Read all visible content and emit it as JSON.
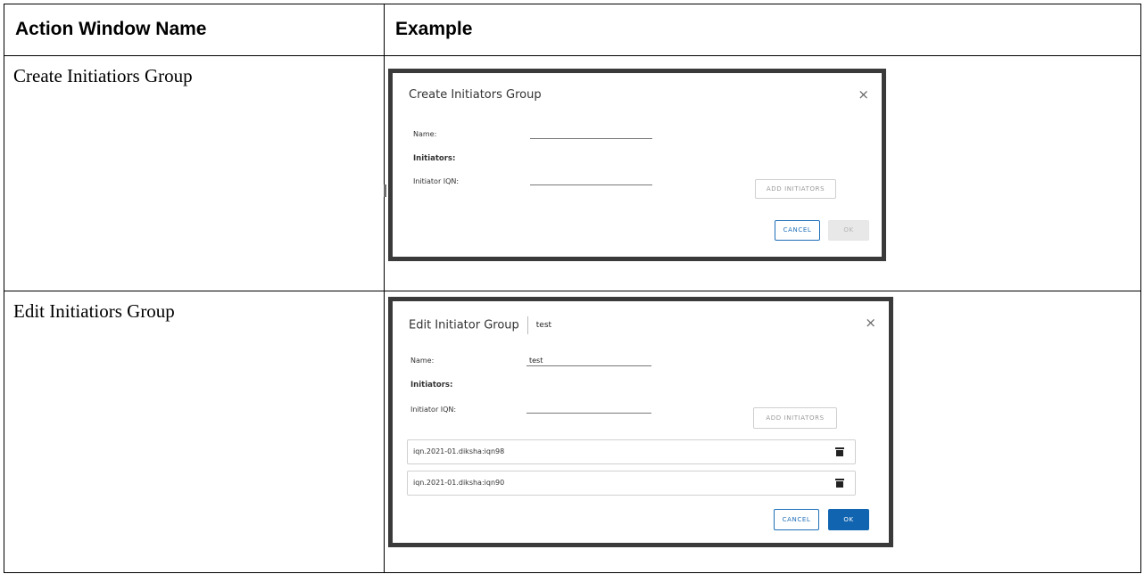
{
  "table": {
    "header_name": "Action Window Name",
    "header_example": "Example",
    "rows": [
      {
        "name": "Create Initiatiors Group"
      },
      {
        "name": "Edit Initiatiors Group"
      }
    ]
  },
  "create_dialog": {
    "title": "Create Initiators Group",
    "close": "×",
    "name_label": "Name:",
    "name_value": "",
    "initiators_label": "Initiators:",
    "initiator_iqn_label": "Initiator IQN:",
    "iqn_value": "",
    "add_initiators": "ADD INITIATORS",
    "cancel": "CANCEL",
    "ok": "OK"
  },
  "edit_dialog": {
    "title": "Edit Initiator Group",
    "subtitle": "test",
    "close": "×",
    "name_label": "Name:",
    "name_value": "test",
    "initiators_label": "Initiators:",
    "initiator_iqn_label": "Initiator IQN:",
    "iqn_value": "",
    "add_initiators": "ADD INITIATORS",
    "iqn_list": [
      "iqn.2021-01.diksha:iqn98",
      "iqn.2021-01.diksha:iqn90"
    ],
    "cancel": "CANCEL",
    "ok": "OK"
  },
  "icons": {
    "close": "close-icon",
    "delete": "trash-icon"
  },
  "colors": {
    "primary": "#1165b0",
    "border": "#000000",
    "frame": "#3a3a3a"
  }
}
